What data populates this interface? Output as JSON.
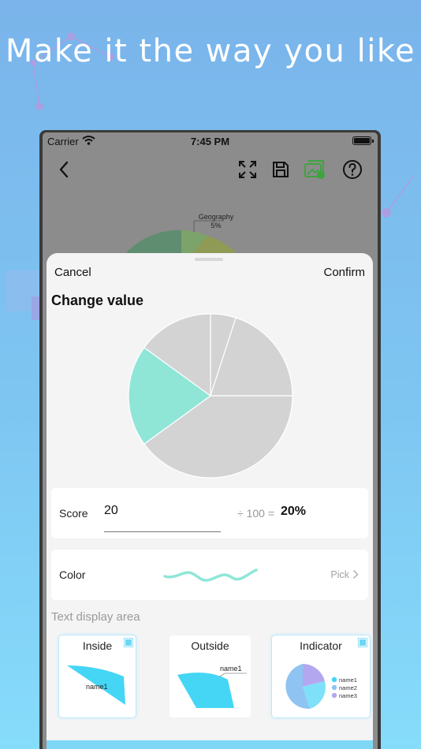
{
  "headline": "Make it the way you like",
  "status_bar": {
    "carrier": "Carrier",
    "time": "7:45 PM",
    "wifi_icon": "wifi-icon",
    "battery_icon": "battery-icon"
  },
  "navbar": {
    "icons": [
      "back-chevron-icon",
      "fullscreen-icon",
      "save-icon",
      "image-export-icon",
      "help-icon"
    ],
    "export_icon_color": "#3fa33f"
  },
  "background_chart": {
    "label": "Geography",
    "percent": "5%"
  },
  "sheet": {
    "cancel_label": "Cancel",
    "confirm_label": "Confirm",
    "title": "Change value",
    "pie_slices": [
      {
        "percent": 5,
        "color": "#d3d3d3"
      },
      {
        "percent": 20,
        "color": "#d3d3d3"
      },
      {
        "percent": 40,
        "color": "#d3d3d3"
      },
      {
        "percent": 20,
        "color": "#8fe6d7",
        "selected": true
      },
      {
        "percent": 15,
        "color": "#d3d3d3"
      }
    ],
    "score": {
      "label": "Score",
      "value": "20",
      "ratio_text": "÷ 100 =",
      "percent_text": "20%"
    },
    "color": {
      "label": "Color",
      "pick_label": "Pick",
      "sample_color": "#8fe6d7"
    },
    "text_display": {
      "section_title": "Text display area",
      "options": [
        {
          "label": "Inside",
          "preview_text": "name1",
          "selected": true
        },
        {
          "label": "Outside",
          "preview_text": "name1",
          "selected": false
        },
        {
          "label": "Indicator",
          "legend": [
            "name1",
            "name2",
            "name3"
          ],
          "selected": true
        }
      ],
      "preview_colors": {
        "primary": "#45d6f5",
        "name1": "#7fe0fa",
        "name2": "#8ec3f2",
        "name3": "#b3a8ef"
      }
    }
  }
}
